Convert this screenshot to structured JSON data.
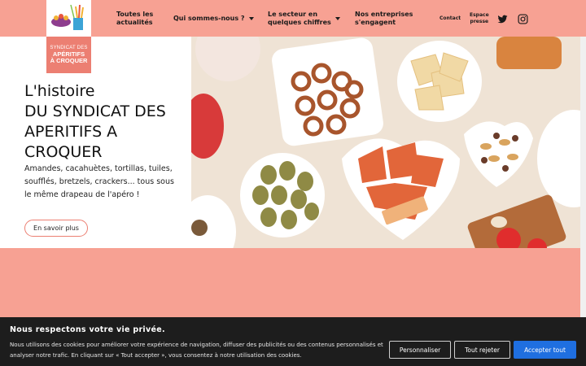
{
  "logo": {
    "line1": "SYNDICAT DES",
    "line2": "APÉRITIFS",
    "line3": "À CROQUER"
  },
  "nav": {
    "news": [
      "Toutes les",
      "actualités"
    ],
    "about": "Qui sommes-nous ?",
    "figures": [
      "Le secteur en",
      "quelques chiffres"
    ],
    "companies": [
      "Nos entreprises",
      "s'engagent"
    ],
    "contact": "Contact",
    "press": [
      "Espace",
      "presse"
    ]
  },
  "social": {
    "twitter_icon": "twitter-icon",
    "instagram_icon": "instagram-icon"
  },
  "hero": {
    "title_lines": [
      "L'histoire",
      "DU SYNDICAT DES",
      "APERITIFS A",
      "CROQUER"
    ],
    "subtitle": "Amandes, cacahuètes, tortillas, tuiles, soufflés, bretzels, crackers... tous sous le même drapeau de l'apéro !",
    "button": "En savoir plus"
  },
  "cookie": {
    "title": "Nous respectons votre vie privée.",
    "text": "Nous utilisons des cookies pour améliorer votre expérience de navigation, diffuser des publicités ou des contenus personnalisés et analyser notre trafic. En cliquant sur « Tout accepter », vous consentez à notre utilisation des cookies.",
    "customize": "Personnaliser",
    "reject": "Tout rejeter",
    "accept": "Accepter tout"
  },
  "colors": {
    "brand": "#f7a193",
    "accent": "#ec7f72",
    "primary_button": "#1f6fe0",
    "banner": "#1d1d1d"
  }
}
